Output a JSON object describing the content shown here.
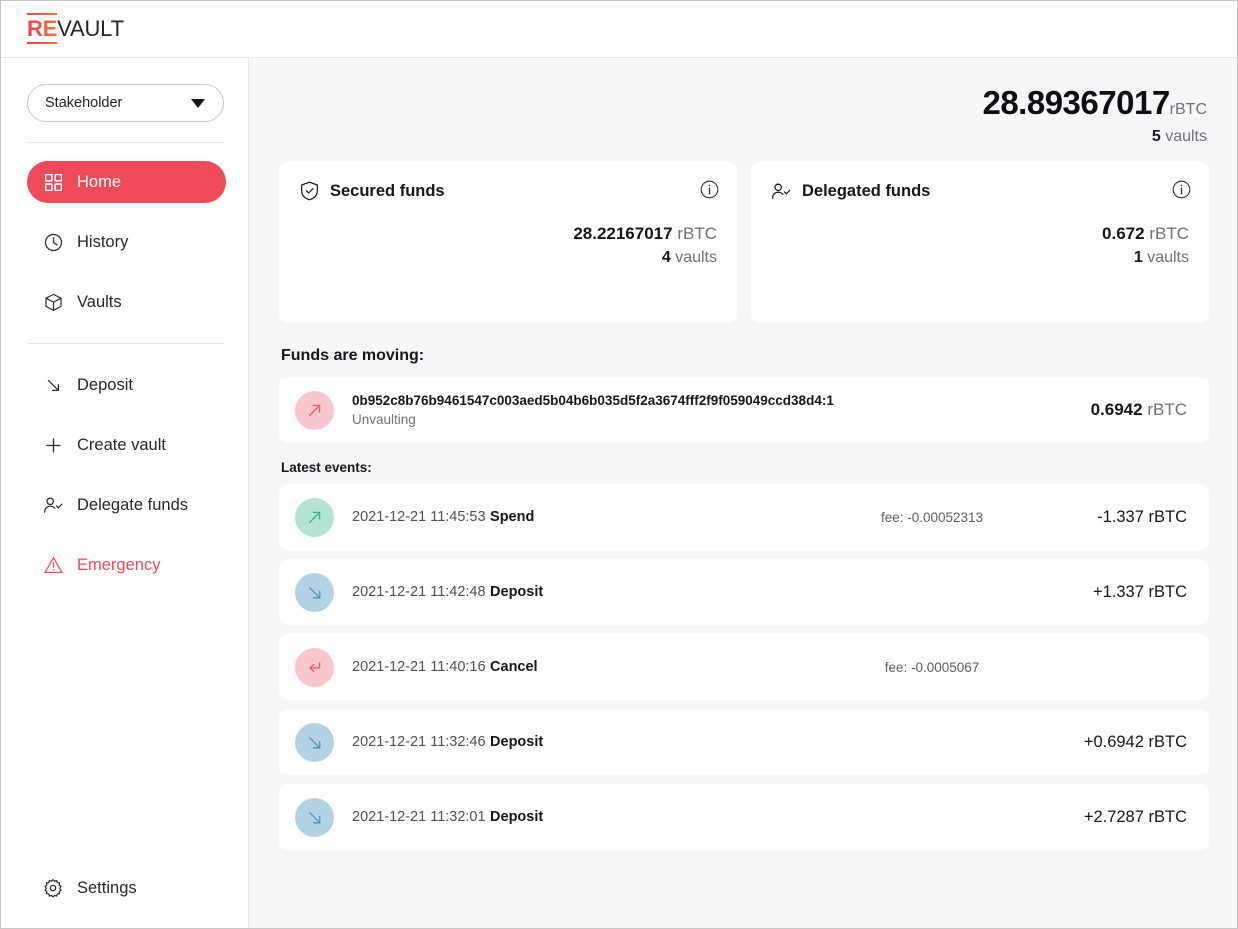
{
  "app": {
    "logo_prefix": "RE",
    "logo_suffix": "VAULT"
  },
  "sidebar": {
    "role_selector": {
      "value": "Stakeholder",
      "icon": "chevron-down-icon"
    },
    "items": [
      {
        "label": "Home",
        "icon": "grid-icon",
        "state": "active"
      },
      {
        "label": "History",
        "icon": "clock-icon",
        "state": "default"
      },
      {
        "label": "Vaults",
        "icon": "box-icon",
        "state": "default"
      },
      {
        "label": "Deposit",
        "icon": "arrow-down-right-icon",
        "state": "default"
      },
      {
        "label": "Create vault",
        "icon": "plus-icon",
        "state": "default"
      },
      {
        "label": "Delegate funds",
        "icon": "user-check-icon",
        "state": "default"
      },
      {
        "label": "Emergency",
        "icon": "warning-triangle-icon",
        "state": "danger"
      }
    ],
    "settings": {
      "label": "Settings",
      "icon": "gear-icon"
    }
  },
  "header": {
    "total_balance": "28.89367017",
    "unit": "rBTC",
    "vault_count": "5",
    "vault_word": "vaults"
  },
  "cards": [
    {
      "title": "Secured funds",
      "icon": "shield-check-icon",
      "info_icon": "info-icon",
      "amount": "28.22167017",
      "unit": "rBTC",
      "vault_count": "4",
      "vault_word": "vaults"
    },
    {
      "title": "Delegated funds",
      "icon": "user-check-icon",
      "info_icon": "info-icon",
      "amount": "0.672",
      "unit": "rBTC",
      "vault_count": "1",
      "vault_word": "vaults"
    }
  ],
  "moving": {
    "section_title": "Funds are moving:",
    "rows": [
      {
        "txid": "0b952c8b76b9461547c003aed5b04b6b035d5f2a3674fff2f9f059049ccd38d4:1",
        "status": "Unvaulting",
        "amount": "0.6942",
        "unit": "rBTC",
        "icon": "arrow-up-right-icon",
        "badge_color": "pink"
      }
    ]
  },
  "events": {
    "section_title": "Latest events:",
    "rows": [
      {
        "date": "2021-12-21 11:45:53",
        "kind": "Spend",
        "fee": "fee: -0.00052313",
        "amount": "-1.337 rBTC",
        "icon": "arrow-up-right-icon",
        "badge_color": "green"
      },
      {
        "date": "2021-12-21 11:42:48",
        "kind": "Deposit",
        "fee": "",
        "amount": "+1.337 rBTC",
        "icon": "arrow-down-right-icon",
        "badge_color": "blue"
      },
      {
        "date": "2021-12-21 11:40:16",
        "kind": "Cancel",
        "fee": "fee: -0.0005067",
        "amount": "",
        "icon": "return-arrow-icon",
        "badge_color": "pink"
      },
      {
        "date": "2021-12-21 11:32:46",
        "kind": "Deposit",
        "fee": "",
        "amount": "+0.6942 rBTC",
        "icon": "arrow-down-right-icon",
        "badge_color": "blue"
      },
      {
        "date": "2021-12-21 11:32:01",
        "kind": "Deposit",
        "fee": "",
        "amount": "+2.7287 rBTC",
        "icon": "arrow-down-right-icon",
        "badge_color": "blue"
      }
    ]
  },
  "colors": {
    "brand_red": "#ef4a5a",
    "logo_gradient_start": "#ef4050",
    "logo_gradient_end": "#f4703e",
    "badge_pink": "#f8c7cd",
    "badge_green": "#b5e3d3",
    "badge_blue": "#b3d3e5",
    "arrow_red": "#e4556a",
    "arrow_green": "#3fae90",
    "arrow_blue": "#4f93bd",
    "canvas": "#f6f7f9"
  }
}
